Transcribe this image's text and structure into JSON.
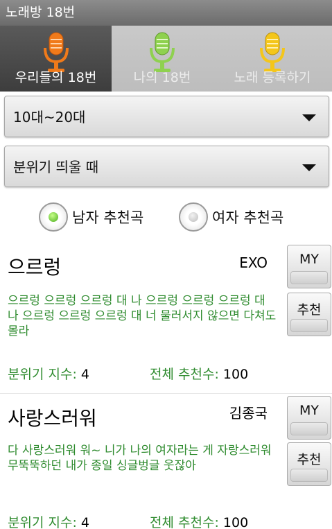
{
  "app": {
    "title": "노래방 18번"
  },
  "tabs": [
    {
      "label": "우리들의 18번",
      "icon": "orange-microphone-icon",
      "color": "#f07a1a",
      "active": true
    },
    {
      "label": "나의 18번",
      "icon": "green-microphone-icon",
      "color": "#8fd14f",
      "active": false
    },
    {
      "label": "노래 등록하기",
      "icon": "yellow-microphone-icon",
      "color": "#f4c61a",
      "active": false
    }
  ],
  "filters": {
    "age": "10대~20대",
    "mood": "분위기 띄울 때"
  },
  "gender": {
    "male_label": "남자 추천곡",
    "female_label": "여자 추천곡",
    "selected": "male"
  },
  "songs": [
    {
      "title": "으르렁",
      "singer": "EXO",
      "lyrics": "으르렁 으르렁 으르렁 대 나 으르렁 으르렁 으르렁 대 나 으르렁 으르렁 으르렁 대 너 물러서지 않으면 다쳐도 몰라",
      "mood_label": "분위기 지수:",
      "mood_value": "4",
      "total_label": "전체 추천수:",
      "total_value": "100",
      "my_label": "MY",
      "recommend_label": "추천"
    },
    {
      "title": "사랑스러워",
      "singer": "김종국",
      "lyrics": "다 사랑스러워 워~ 니가 나의 여자라는 게 자랑스러워 무뚝뚝하던 내가 종일 싱글벙글 웃잖아",
      "mood_label": "분위기 지수:",
      "mood_value": "4",
      "total_label": "전체 추천수:",
      "total_value": "100",
      "my_label": "MY",
      "recommend_label": "추천"
    }
  ],
  "colors": {
    "accent_green": "#2e8b2e",
    "tab_active": "#3d3d3d",
    "tab_inactive": "#c4c4c4"
  }
}
